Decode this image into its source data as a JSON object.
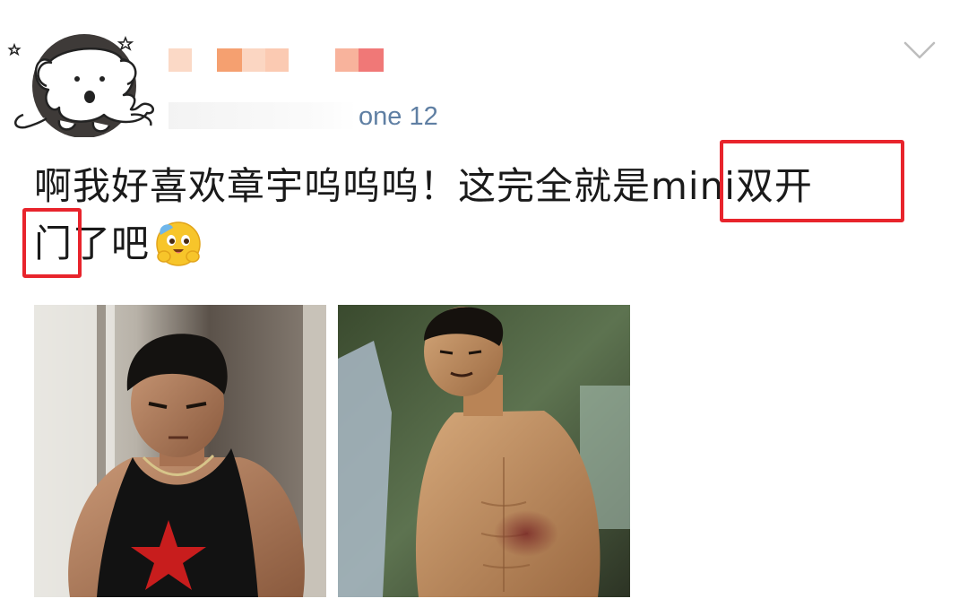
{
  "post": {
    "author_name_pixelated": true,
    "device": "one 12",
    "text_line1": "啊我好喜欢章宇呜呜呜！这完全就是mini双开",
    "text_line2": "门了吧",
    "emoji": "hugging-face-emoji",
    "highlight_color": "#e8242c",
    "device_color": "#5f7fa3"
  },
  "images": [
    {
      "name": "photo-man-black-tank-top"
    },
    {
      "name": "photo-man-shirtless"
    }
  ],
  "icons": {
    "avatar": "cartoon-dog-avatar",
    "menu": "chevron-down-icon"
  }
}
